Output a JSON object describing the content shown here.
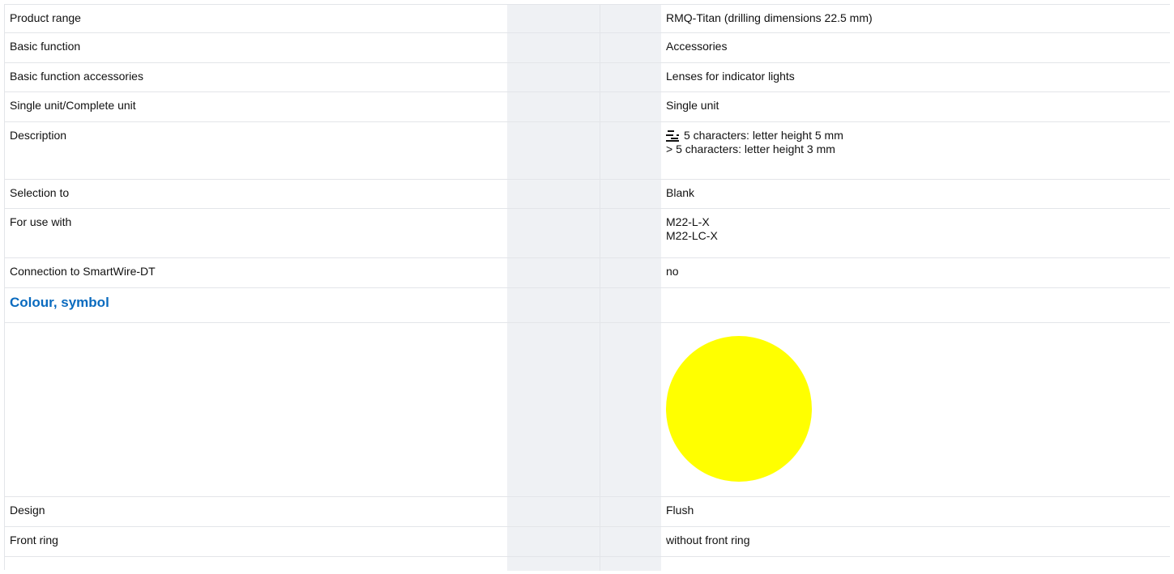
{
  "rows": [
    {
      "label": "Product range",
      "value": "RMQ-Titan (drilling dimensions 22.5 mm)"
    },
    {
      "label": "Basic function",
      "value": "Accessories"
    },
    {
      "label": "Basic function accessories",
      "value": "Lenses for indicator lights"
    },
    {
      "label": "Single unit/Complete unit",
      "value": "Single unit"
    }
  ],
  "description": {
    "label": "Description",
    "icon": "engraving-icon",
    "line1": "5 characters: letter height 5 mm",
    "line2": "> 5 characters: letter height 3 mm"
  },
  "selection": {
    "label": "Selection to",
    "value": "Blank"
  },
  "for_use_with": {
    "label": "For use with",
    "values": [
      "M22-L-X",
      "M22-LC-X"
    ]
  },
  "smartwire": {
    "label": "Connection to SmartWire-DT",
    "value": "no"
  },
  "section": {
    "title": "Colour, symbol"
  },
  "swatch": {
    "color": "#ffff00"
  },
  "rows_bottom": [
    {
      "label": "Design",
      "value": "Flush"
    },
    {
      "label": "Front ring",
      "value": "without front ring"
    }
  ],
  "colors": {
    "heading": "#0a6bbf",
    "band": "#eff1f4",
    "border": "#e3e5e9"
  }
}
